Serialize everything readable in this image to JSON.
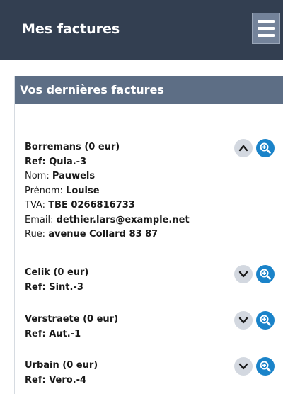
{
  "header": {
    "title": "Mes factures",
    "menu_icon": "hamburger-icon"
  },
  "panel": {
    "title": "Vos dernières factures"
  },
  "invoices": [
    {
      "title": "Borremans (0 eur)",
      "ref": "Ref: Quia.-3",
      "expanded": true,
      "details": [
        {
          "label": "Nom: ",
          "value": "Pauwels"
        },
        {
          "label": "Prénom: ",
          "value": "Louise"
        },
        {
          "label": "TVA: ",
          "value": "TBE 0266816733"
        },
        {
          "label": "Email: ",
          "value": "dethier.lars@example.net"
        },
        {
          "label": "Rue: ",
          "value": "avenue Collard 83 87"
        }
      ]
    },
    {
      "title": "Celik (0 eur)",
      "ref": "Ref: Sint.-3",
      "expanded": false
    },
    {
      "title": "Verstraete (0 eur)",
      "ref": "Ref: Aut.-1",
      "expanded": false
    },
    {
      "title": "Urbain (0 eur)",
      "ref": "Ref: Vero.-4",
      "expanded": false
    }
  ],
  "icons": {
    "collapse": "chevron-up-icon",
    "expand": "chevron-down-icon",
    "zoom": "zoom-in-icon"
  },
  "colors": {
    "topbar": "#333f51",
    "panel_header": "#5d6e85",
    "zoom_button": "#1a83c9",
    "toggle_button": "#d3d8e0"
  }
}
